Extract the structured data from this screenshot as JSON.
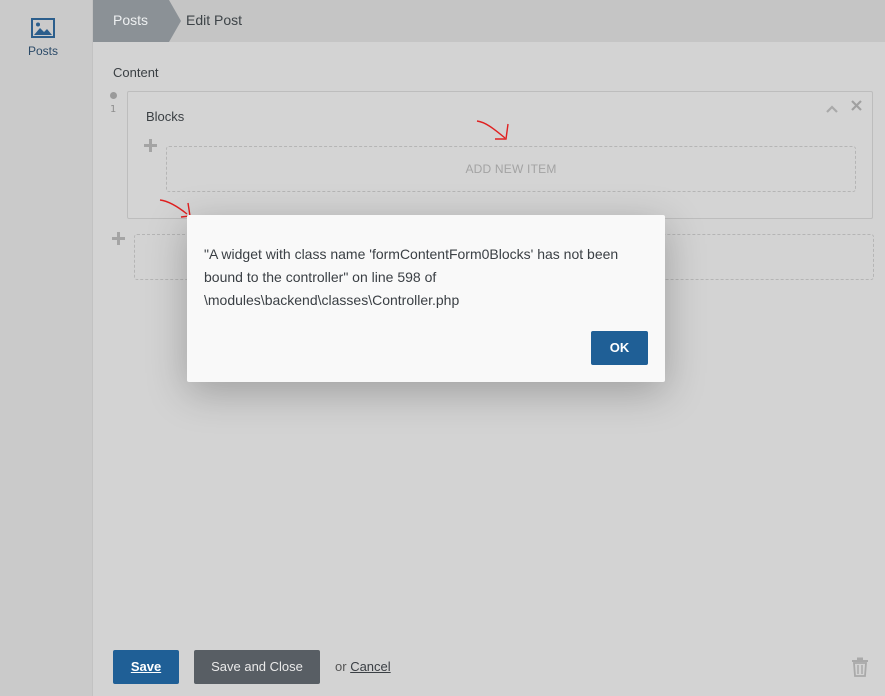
{
  "sidebar": {
    "items": [
      {
        "label": "Posts",
        "icon": "image-icon"
      }
    ]
  },
  "breadcrumb": {
    "parent": "Posts",
    "current": "Edit Post"
  },
  "form": {
    "content_label": "Content",
    "index": "1",
    "blocks_label": "Blocks",
    "add_new_item": "ADD NEW ITEM"
  },
  "footer": {
    "save_label": "Save",
    "save_close_label": "Save and Close",
    "or_text": "or",
    "cancel_label": "Cancel"
  },
  "modal": {
    "message": "\"A widget with class name 'formContentForm0Blocks' has not been bound to the controller\" on line 598 of \\modules\\backend\\classes\\Controller.php",
    "ok_label": "OK"
  },
  "colors": {
    "primary": "#1f5f96",
    "secondary_button": "#585e64",
    "breadcrumb_active": "#8b9196",
    "annotation": "#e02020"
  }
}
